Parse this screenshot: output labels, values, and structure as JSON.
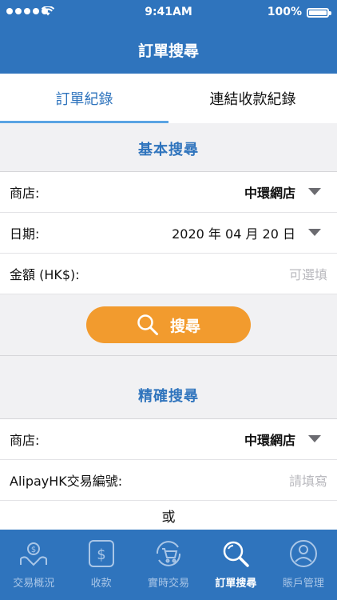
{
  "status_bar": {
    "time": "9:41AM",
    "battery": "100%"
  },
  "nav": {
    "title": "訂單搜尋"
  },
  "tabs": [
    {
      "label": "訂單紀錄",
      "active": true
    },
    {
      "label": "連結收款紀錄",
      "active": false
    }
  ],
  "basic_search": {
    "heading": "基本搜尋",
    "store_label": "商店:",
    "store_value": "中環網店",
    "date_label": "日期:",
    "date_value": "2020 年 04 月 20 日",
    "amount_label": "金額 (HK$):",
    "amount_placeholder": "可選填",
    "search_button": "搜尋"
  },
  "precise_search": {
    "heading": "精確搜尋",
    "store_label": "商店:",
    "store_value": "中環網店",
    "txn_label": "AlipayHK交易編號:",
    "txn_placeholder": "請填寫",
    "or_text": "或"
  },
  "tab_bar": [
    {
      "label": "交易概況",
      "icon": "hand-coin-icon"
    },
    {
      "label": "收款",
      "icon": "dollar-phone-icon"
    },
    {
      "label": "實時交易",
      "icon": "cart-refresh-icon"
    },
    {
      "label": "訂單搜尋",
      "icon": "search-icon",
      "active": true
    },
    {
      "label": "賬戶管理",
      "icon": "user-icon"
    }
  ],
  "colors": {
    "primary": "#2f74bd",
    "accent": "#f29b2e",
    "tab_inactive": "#a9c6e7"
  }
}
